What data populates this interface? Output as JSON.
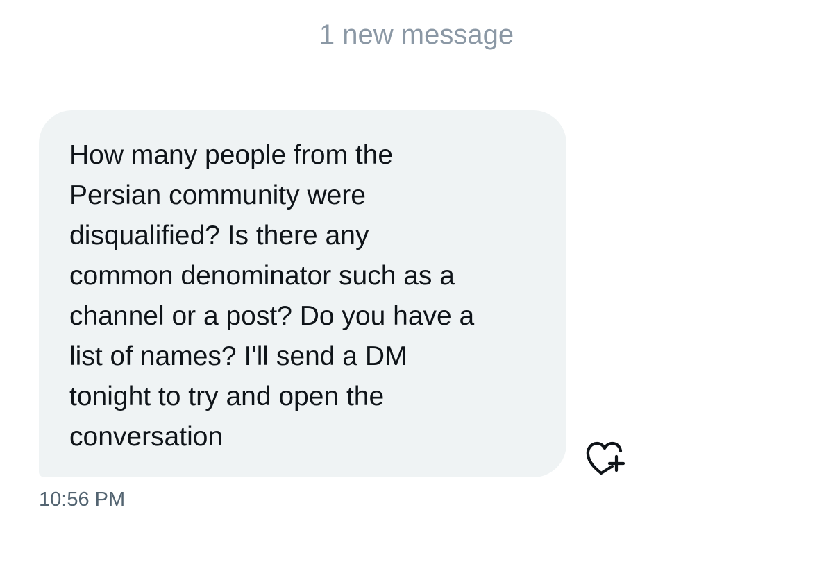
{
  "divider": {
    "label": "1 new message"
  },
  "message": {
    "text": "How many people from the\nPersian community were\ndisqualified? Is there any\ncommon denominator such as a\nchannel or a post? Do you have a\nlist of names? I'll send a DM\ntonight to try and open the\nconversation",
    "timestamp": "10:56 PM",
    "bubble_color": "#eff3f4",
    "text_color": "#0f1419"
  },
  "actions": {
    "react_icon": "heart-plus-icon"
  }
}
